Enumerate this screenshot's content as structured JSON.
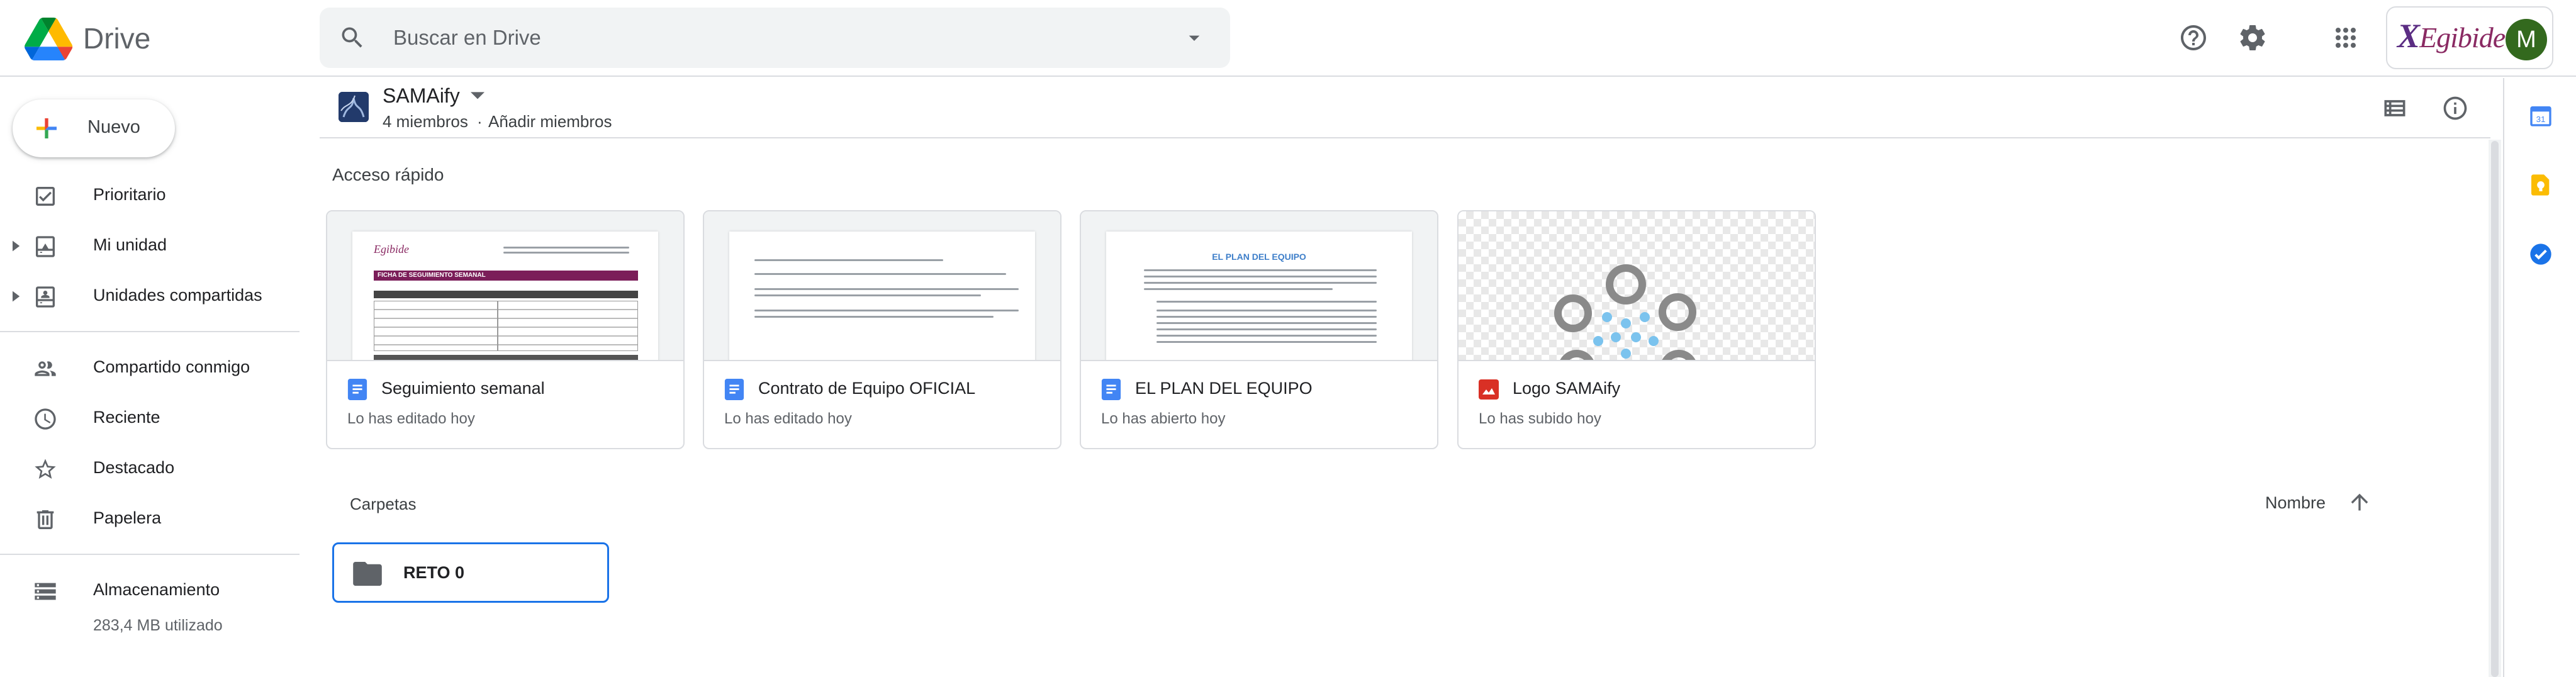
{
  "app": {
    "name": "Drive"
  },
  "search": {
    "placeholder": "Buscar en Drive"
  },
  "header": {
    "org_logo_mark": "X",
    "org_logo_text": "Egibide",
    "avatar_initial": "M"
  },
  "nav": {
    "new_label": "Nuevo",
    "items": [
      {
        "label": "Prioritario",
        "icon": "priority-icon"
      },
      {
        "label": "Mi unidad",
        "icon": "my-drive-icon"
      },
      {
        "label": "Unidades compartidas",
        "icon": "shared-drives-icon"
      },
      {
        "label": "Compartido conmigo",
        "icon": "shared-with-me-icon"
      },
      {
        "label": "Reciente",
        "icon": "clock-icon"
      },
      {
        "label": "Destacado",
        "icon": "star-icon"
      },
      {
        "label": "Papelera",
        "icon": "trash-icon"
      }
    ],
    "storage": {
      "label": "Almacenamiento",
      "used": "283,4 MB utilizado"
    }
  },
  "drive": {
    "name": "SAMAify",
    "members": "4 miembros",
    "separator": "·",
    "add_members": "Añadir miembros"
  },
  "quick_access": {
    "title": "Acceso rápido",
    "cards": [
      {
        "name": "Seguimiento semanal",
        "meta": "Lo has editado hoy",
        "type": "doc"
      },
      {
        "name": "Contrato de Equipo OFICIAL",
        "meta": "Lo has editado hoy",
        "type": "doc"
      },
      {
        "name": "EL PLAN DEL EQUIPO",
        "meta": "Lo has abierto hoy",
        "type": "doc",
        "preview_heading": "EL PLAN DEL EQUIPO"
      },
      {
        "name": "Logo SAMAify",
        "meta": "Lo has subido hoy",
        "type": "image"
      }
    ],
    "preview_1": {
      "org": "Egibide",
      "heading": "FICHA DE SEGUIMIENTO SEMANAL"
    }
  },
  "folders": {
    "title": "Carpetas",
    "sort_label": "Nombre",
    "items": [
      {
        "name": "RETO 0"
      }
    ]
  },
  "colors": {
    "accent": "#1a73e8",
    "avatar_bg": "#33691e",
    "doc_blue": "#4285f4",
    "image_red": "#d93025",
    "org_purple": "#8a2a63"
  }
}
